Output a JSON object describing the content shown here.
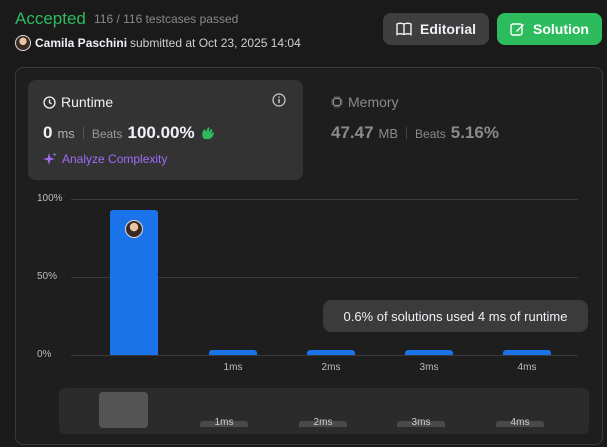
{
  "header": {
    "status": "Accepted",
    "testcases": "116 / 116 testcases passed",
    "user": "Camila Paschini",
    "submitted": "submitted at Oct 23, 2025 14:04",
    "editorial_label": "Editorial",
    "solution_label": "Solution"
  },
  "runtime": {
    "title": "Runtime",
    "value": "0",
    "unit": "ms",
    "beats_label": "Beats",
    "beats_value": "100.00%",
    "analyze_label": "Analyze Complexity"
  },
  "memory": {
    "title": "Memory",
    "value": "47.47",
    "unit": "MB",
    "beats_label": "Beats",
    "beats_value": "5.16%"
  },
  "chart_data": {
    "type": "bar",
    "y_ticks": [
      "100%",
      "50%",
      "0%"
    ],
    "x_labels": [
      "1ms",
      "2ms",
      "3ms",
      "4ms"
    ],
    "values": [
      100,
      0.6,
      0.6,
      0.6,
      0.6
    ],
    "ylim": [
      0,
      100
    ]
  },
  "tooltip": "0.6% of solutions used 4 ms of runtime",
  "mini": {
    "labels": [
      "1ms",
      "2ms",
      "3ms",
      "4ms"
    ]
  },
  "colors": {
    "accepted": "#2cbb5d",
    "bar": "#1a73e8",
    "analyze": "#a06cf7"
  }
}
